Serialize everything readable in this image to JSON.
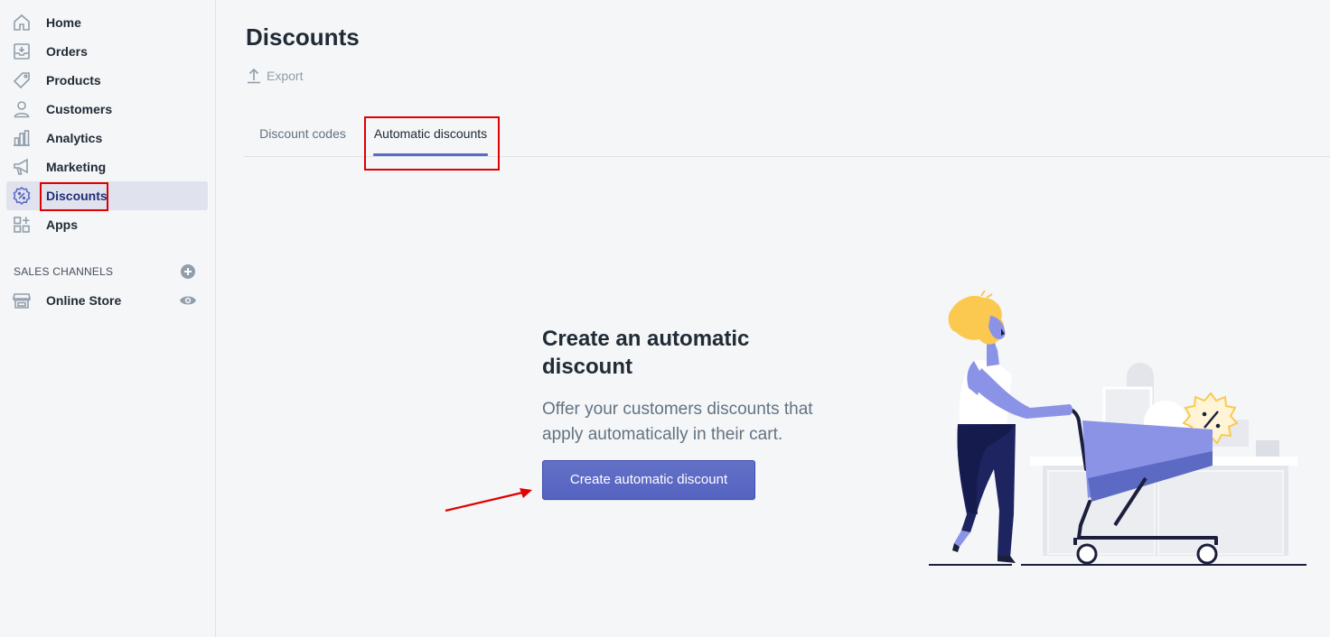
{
  "sidebar": {
    "items": [
      {
        "label": "Home",
        "icon": "home-icon"
      },
      {
        "label": "Orders",
        "icon": "orders-icon"
      },
      {
        "label": "Products",
        "icon": "tag-icon"
      },
      {
        "label": "Customers",
        "icon": "person-icon"
      },
      {
        "label": "Analytics",
        "icon": "bar-chart-icon"
      },
      {
        "label": "Marketing",
        "icon": "megaphone-icon"
      },
      {
        "label": "Discounts",
        "icon": "discount-badge-icon",
        "active": true
      },
      {
        "label": "Apps",
        "icon": "apps-grid-icon"
      }
    ],
    "sales_channels_title": "SALES CHANNELS",
    "online_store_label": "Online Store"
  },
  "page": {
    "title": "Discounts",
    "export_label": "Export"
  },
  "tabs": [
    {
      "label": "Discount codes",
      "selected": false
    },
    {
      "label": "Automatic discounts",
      "selected": true
    }
  ],
  "empty_state": {
    "heading": "Create an automatic discount",
    "description": "Offer your customers discounts that apply automatically in their cart.",
    "button_label": "Create automatic discount"
  },
  "colors": {
    "accent": "#5c6ac4",
    "highlight_annotation": "#e00000",
    "active_nav_bg": "#e0e3ed"
  }
}
